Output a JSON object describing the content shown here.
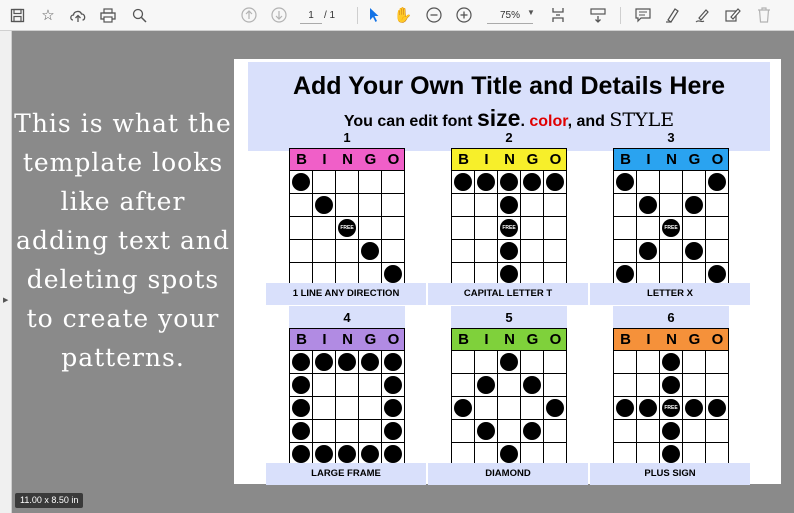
{
  "toolbar": {
    "icons": [
      "save-icon",
      "star-icon",
      "cloud-upload-icon",
      "print-icon",
      "zoom-search-icon",
      "page-up-icon",
      "page-down-icon",
      "select-cursor-icon",
      "hand-icon",
      "zoom-out-icon",
      "zoom-in-icon",
      "fit-page-icon",
      "scroll-mode-icon",
      "comment-icon",
      "highlight-icon",
      "sign-icon",
      "edit-text-icon",
      "delete-icon"
    ],
    "page_current": "1",
    "page_total": "/ 1",
    "zoom": "75%"
  },
  "side_text": "This is what the template looks like after adding text and deleting spots to create your patterns.",
  "page_size": "11.00 x 8.50 in",
  "document": {
    "title": "Add Your Own Title and Details Here",
    "subtitle": {
      "part1": "You can edit font ",
      "size_word": "size",
      "part2": ", ",
      "color_word": "color",
      "part3": ", and ",
      "style_word": "STYLE"
    },
    "bingo_letters": [
      "B",
      "I",
      "N",
      "G",
      "O"
    ],
    "free_label": "FREE",
    "cards": [
      {
        "number": "1",
        "header_color": "#f05fc8",
        "label": "1 LINE ANY DIRECTION",
        "grid": [
          [
            1,
            0,
            0,
            0,
            0
          ],
          [
            0,
            1,
            0,
            0,
            0
          ],
          [
            0,
            0,
            2,
            0,
            0
          ],
          [
            0,
            0,
            0,
            1,
            0
          ],
          [
            0,
            0,
            0,
            0,
            1
          ]
        ]
      },
      {
        "number": "2",
        "header_color": "#f7ef2a",
        "label": "CAPITAL LETTER T",
        "grid": [
          [
            1,
            1,
            1,
            1,
            1
          ],
          [
            0,
            0,
            1,
            0,
            0
          ],
          [
            0,
            0,
            2,
            0,
            0
          ],
          [
            0,
            0,
            1,
            0,
            0
          ],
          [
            0,
            0,
            1,
            0,
            0
          ]
        ]
      },
      {
        "number": "3",
        "header_color": "#2aa3f0",
        "label": "LETTER X",
        "grid": [
          [
            1,
            0,
            0,
            0,
            1
          ],
          [
            0,
            1,
            0,
            1,
            0
          ],
          [
            0,
            0,
            2,
            0,
            0
          ],
          [
            0,
            1,
            0,
            1,
            0
          ],
          [
            1,
            0,
            0,
            0,
            1
          ]
        ]
      },
      {
        "number": "4",
        "header_color": "#b18be3",
        "label": "LARGE FRAME",
        "grid": [
          [
            1,
            1,
            1,
            1,
            1
          ],
          [
            1,
            0,
            0,
            0,
            1
          ],
          [
            1,
            0,
            0,
            0,
            1
          ],
          [
            1,
            0,
            0,
            0,
            1
          ],
          [
            1,
            1,
            1,
            1,
            1
          ]
        ]
      },
      {
        "number": "5",
        "header_color": "#7fd13b",
        "label": "DIAMOND",
        "grid": [
          [
            0,
            0,
            1,
            0,
            0
          ],
          [
            0,
            1,
            0,
            1,
            0
          ],
          [
            1,
            0,
            0,
            0,
            1
          ],
          [
            0,
            1,
            0,
            1,
            0
          ],
          [
            0,
            0,
            1,
            0,
            0
          ]
        ]
      },
      {
        "number": "6",
        "header_color": "#f5913a",
        "label": "PLUS SIGN",
        "grid": [
          [
            0,
            0,
            1,
            0,
            0
          ],
          [
            0,
            0,
            1,
            0,
            0
          ],
          [
            1,
            1,
            2,
            1,
            1
          ],
          [
            0,
            0,
            1,
            0,
            0
          ],
          [
            0,
            0,
            1,
            0,
            0
          ]
        ]
      }
    ]
  }
}
